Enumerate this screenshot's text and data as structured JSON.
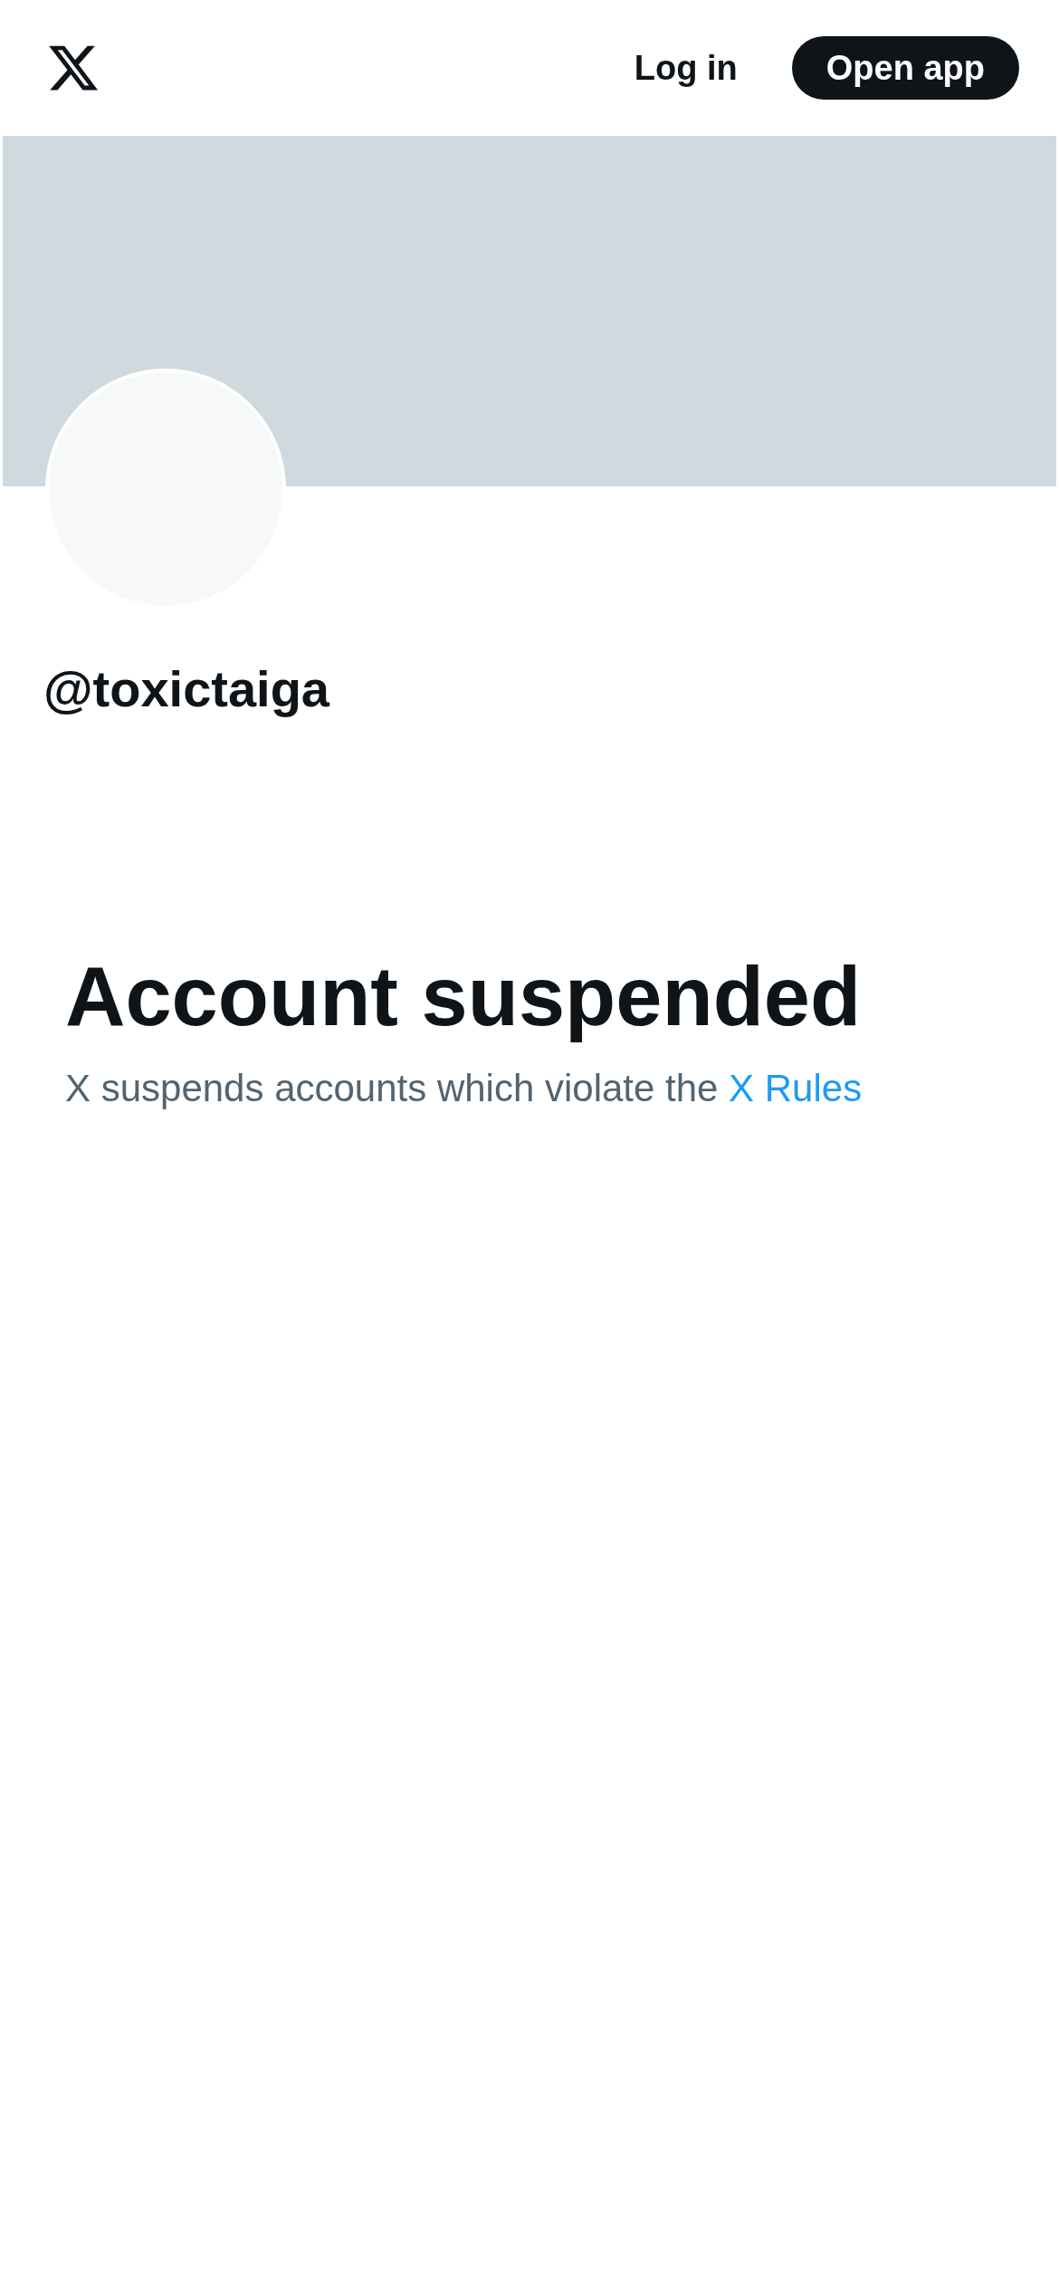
{
  "header": {
    "login": "Log in",
    "open_app": "Open app"
  },
  "profile": {
    "handle": "@toxictaiga"
  },
  "notice": {
    "title": "Account suspended",
    "text": "X suspends accounts which violate the",
    "link": "X Rules"
  }
}
